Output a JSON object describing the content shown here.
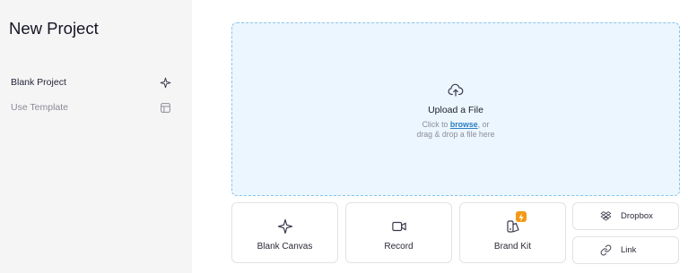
{
  "sidebar": {
    "title": "New Project",
    "items": [
      {
        "label": "Blank Project",
        "icon": "sparkle-icon",
        "active": true
      },
      {
        "label": "Use Template",
        "icon": "layout-template-icon",
        "active": false
      }
    ]
  },
  "upload": {
    "title": "Upload a File",
    "hint_prefix": "Click to ",
    "browse_label": "browse",
    "hint_suffix": ", or",
    "hint_line2": "drag & drop a file here",
    "icon": "cloud-upload-icon"
  },
  "options": {
    "blank_canvas": {
      "label": "Blank Canvas",
      "icon": "sparkle-icon"
    },
    "record": {
      "label": "Record",
      "icon": "video-camera-icon"
    },
    "brand_kit": {
      "label": "Brand Kit",
      "icon": "brand-kit-icon",
      "badge_icon": "lightning-bolt-icon"
    },
    "dropbox": {
      "label": "Dropbox",
      "icon": "dropbox-icon"
    },
    "link": {
      "label": "Link",
      "icon": "link-icon"
    }
  },
  "colors": {
    "sidebar_bg": "#f5f5f6",
    "dropzone_bg": "#ebf6fe",
    "dropzone_border": "#8cc4ec",
    "link_blue": "#2c7fc4",
    "badge_orange": "#f39a16"
  }
}
